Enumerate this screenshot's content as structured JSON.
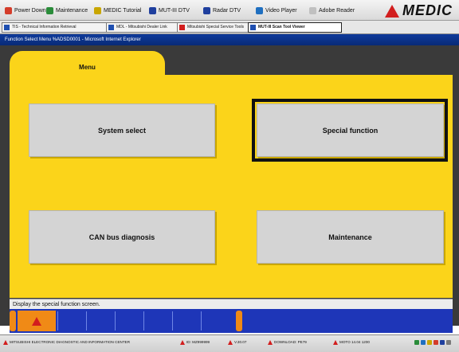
{
  "toolbar": {
    "items": [
      {
        "label": "Power Down",
        "color": "#d43c2a"
      },
      {
        "label": "Maintenance",
        "color": "#2a8c3a"
      },
      {
        "label": "MEDIC Tutorial",
        "color": "#c9a600"
      },
      {
        "label": "MUT-III DTV",
        "color": "#1f3f9e"
      },
      {
        "label": "Radar DTV",
        "color": "#1f3f9e"
      },
      {
        "label": "Video Player",
        "color": "#1f6fc0"
      },
      {
        "label": "Adobe Reader",
        "color": "#c0c0c0"
      }
    ],
    "brand": "MEDIC"
  },
  "tabs": [
    {
      "label": "TIS - Technical Information Retrieval",
      "active": false
    },
    {
      "label": "MDL - Mitsubishi Dealer Link",
      "active": false
    },
    {
      "label": "Mitsubishi Special Service Tools",
      "active": false
    },
    {
      "label": "MUT-III Scan Tool Viewer",
      "active": true
    }
  ],
  "window_title": "Function Select Menu  %ADSD0001  - Microsoft Internet Explorer",
  "menu_tab": "Menu",
  "buttons": {
    "system_select": "System select",
    "special_function": "Special function",
    "can_bus": "CAN bus diagnosis",
    "maintenance": "Maintenance"
  },
  "selected_button": "special_function",
  "status_text": "Display the special function screen.",
  "taskbar": [
    "MITSUBISHI ELECTRONIC DIAGNOSTIC AND INFORMATION CENTER",
    "ID: MZ999999",
    "V.30.07",
    "DOWNLOAD: PE79",
    "MOTO 14.04 1200"
  ],
  "colors": {
    "panel_yellow": "#fbd41a",
    "function_bar_blue": "#1e36b8",
    "accent_orange": "#f08a16",
    "brand_red": "#d21e1e"
  }
}
